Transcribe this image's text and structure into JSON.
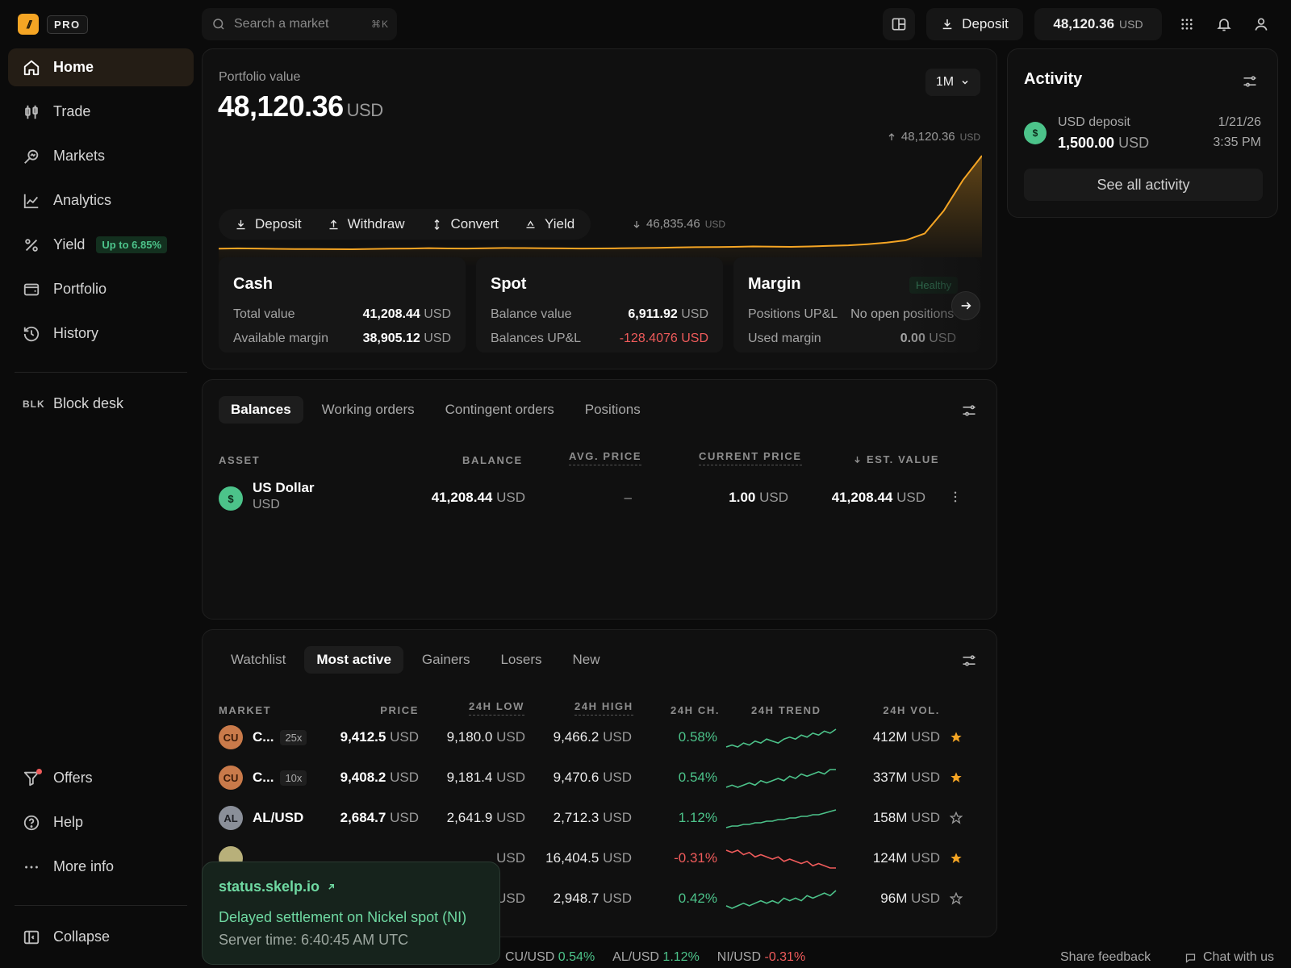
{
  "brand": {
    "logo_glyph": "//",
    "badge": "PRO",
    "accent": "#f5a524"
  },
  "nav": {
    "items": [
      {
        "label": "Home",
        "icon": "home-icon",
        "active": true
      },
      {
        "label": "Trade",
        "icon": "candles-icon"
      },
      {
        "label": "Markets",
        "icon": "markets-icon"
      },
      {
        "label": "Analytics",
        "icon": "chart-line-icon"
      },
      {
        "label": "Yield",
        "icon": "percent-icon",
        "badge": "Up to 6.85%"
      },
      {
        "label": "Portfolio",
        "icon": "wallet-icon"
      },
      {
        "label": "History",
        "icon": "history-icon"
      }
    ],
    "block_desk": {
      "tag": "BLK",
      "label": "Block desk"
    },
    "bottom": [
      {
        "label": "Offers",
        "icon": "offers-icon"
      },
      {
        "label": "Help",
        "icon": "help-icon"
      },
      {
        "label": "More info",
        "icon": "more-icon"
      }
    ],
    "collapse": "Collapse"
  },
  "topbar": {
    "search_placeholder": "Search a market",
    "search_shortcut": "⌘K",
    "deposit_label": "Deposit",
    "balance_value": "48,120.36",
    "balance_unit": "USD"
  },
  "portfolio": {
    "label": "Portfolio value",
    "value": "48,120.36",
    "unit": "USD",
    "range": "1M",
    "high": "48,120.36",
    "low": "46,835.46",
    "chart_unit": "USD",
    "actions": [
      "Deposit",
      "Withdraw",
      "Convert",
      "Yield"
    ],
    "series": [
      46900,
      46905,
      46902,
      46898,
      46895,
      46896,
      46894,
      46893,
      46897,
      46900,
      46903,
      46908,
      46904,
      46902,
      46906,
      46910,
      46909,
      46907,
      46905,
      46903,
      46904,
      46906,
      46909,
      46912,
      46916,
      46920,
      46922,
      46925,
      46930,
      46928,
      46925,
      46930,
      46938,
      46945,
      46960,
      46980,
      47010,
      47100,
      47400,
      47800,
      48120
    ]
  },
  "accounts": {
    "cash": {
      "title": "Cash",
      "rows": [
        {
          "k": "Total value",
          "v": "41,208.44",
          "u": "USD"
        },
        {
          "k": "Available margin",
          "v": "38,905.12",
          "u": "USD"
        }
      ]
    },
    "spot": {
      "title": "Spot",
      "rows": [
        {
          "k": "Balance value",
          "v": "6,911.92",
          "u": "USD"
        },
        {
          "k": "Balances UP&L",
          "v": "-128.4076 USD",
          "u": ""
        }
      ]
    },
    "margin": {
      "title": "Margin",
      "badge": "Healthy",
      "rows": [
        {
          "k": "Positions UP&L",
          "v": "No open positions"
        },
        {
          "k": "Used margin",
          "v": "0.00",
          "u": "USD"
        }
      ]
    }
  },
  "balances": {
    "tabs": [
      "Balances",
      "Working orders",
      "Contingent orders",
      "Positions"
    ],
    "headers": {
      "asset": "ASSET",
      "balance": "BALANCE",
      "avg": "AVG. PRICE",
      "current": "CURRENT PRICE",
      "est": "EST. VALUE"
    },
    "rows": [
      {
        "icon": "$",
        "name": "US Dollar",
        "code": "USD",
        "balance": "41,208.44",
        "bal_unit": "USD",
        "avg": "–",
        "current": "1.00",
        "cur_unit": "USD",
        "est": "41,208.44",
        "est_unit": "USD"
      }
    ]
  },
  "markets": {
    "tabs": [
      "Watchlist",
      "Most active",
      "Gainers",
      "Losers",
      "New"
    ],
    "headers": {
      "market": "MARKET",
      "price": "PRICE",
      "low": "24H LOW",
      "high": "24H HIGH",
      "change": "24H CH.",
      "trend": "24H TREND",
      "vol": "24H VOL."
    },
    "unit": "USD",
    "rows": [
      {
        "icon": "CU",
        "icon_bg": "#c97a4a",
        "icon_fg": "#3a1a08",
        "name": "C...",
        "lev": "25x",
        "price": "9,412.5",
        "low": "9,180.0",
        "high": "9,466.2",
        "change": "0.58%",
        "dir": "up",
        "vol": "412M",
        "starred": true,
        "trend": [
          5,
          6,
          5,
          7,
          6,
          8,
          7,
          9,
          8,
          7,
          9,
          10,
          9,
          11,
          10,
          12,
          11,
          13,
          12,
          14
        ]
      },
      {
        "icon": "CU",
        "icon_bg": "#c97a4a",
        "icon_fg": "#3a1a08",
        "name": "C...",
        "lev": "10x",
        "price": "9,408.2",
        "low": "9,181.4",
        "high": "9,470.6",
        "change": "0.54%",
        "dir": "up",
        "vol": "337M",
        "starred": true,
        "trend": [
          5,
          6,
          5,
          6,
          7,
          6,
          8,
          7,
          8,
          9,
          8,
          10,
          9,
          11,
          10,
          11,
          12,
          11,
          13,
          13
        ]
      },
      {
        "icon": "AL",
        "icon_bg": "#8a8f99",
        "icon_fg": "#1d1f24",
        "name": "AL/USD",
        "lev": "",
        "price": "2,684.7",
        "low": "2,641.9",
        "high": "2,712.3",
        "change": "1.12%",
        "dir": "up",
        "vol": "158M",
        "starred": false,
        "trend": [
          3,
          4,
          4,
          5,
          5,
          6,
          6,
          7,
          7,
          8,
          8,
          9,
          9,
          10,
          10,
          11,
          11,
          12,
          13,
          14
        ]
      },
      {
        "icon": "",
        "icon_bg": "#b8b07a",
        "icon_fg": "#222",
        "name": "",
        "lev": "",
        "price": "",
        "low": "USD",
        "high": "16,404.5",
        "change": "-0.31%",
        "dir": "down",
        "vol": "124M",
        "starred": true,
        "trend": [
          13,
          12,
          13,
          11,
          12,
          10,
          11,
          10,
          9,
          10,
          8,
          9,
          8,
          7,
          8,
          6,
          7,
          6,
          5,
          5
        ]
      },
      {
        "icon": "",
        "icon_bg": "#888",
        "icon_fg": "#222",
        "name": "",
        "lev": "",
        "price": "",
        "low": "USD",
        "high": "2,948.7",
        "change": "0.42%",
        "dir": "up",
        "vol": "96M",
        "starred": false,
        "trend": [
          6,
          5,
          6,
          7,
          6,
          7,
          8,
          7,
          8,
          7,
          9,
          8,
          9,
          8,
          10,
          9,
          10,
          11,
          10,
          12
        ]
      }
    ]
  },
  "activity": {
    "title": "Activity",
    "item": {
      "icon": "$",
      "label": "USD deposit",
      "amount": "1,500.00",
      "unit": "USD",
      "date": "1/21/26",
      "time": "3:35 PM"
    },
    "see_all": "See all activity"
  },
  "status": {
    "link": "status.skelp.io",
    "message": "Delayed settlement on Nickel spot (NI)",
    "server_time": "Server time: 6:40:45 AM UTC"
  },
  "ticker": [
    {
      "name": "CU/USD",
      "change": "0.54%",
      "dir": "up"
    },
    {
      "name": "AL/USD",
      "change": "1.12%",
      "dir": "up"
    },
    {
      "name": "NI/USD",
      "change": "-0.31%",
      "dir": "down"
    }
  ],
  "footer": {
    "feedback": "Share feedback",
    "chat": "Chat with us"
  },
  "colors": {
    "up": "#4cc38a",
    "down": "#ef5b5b",
    "star": "#f5a524"
  }
}
